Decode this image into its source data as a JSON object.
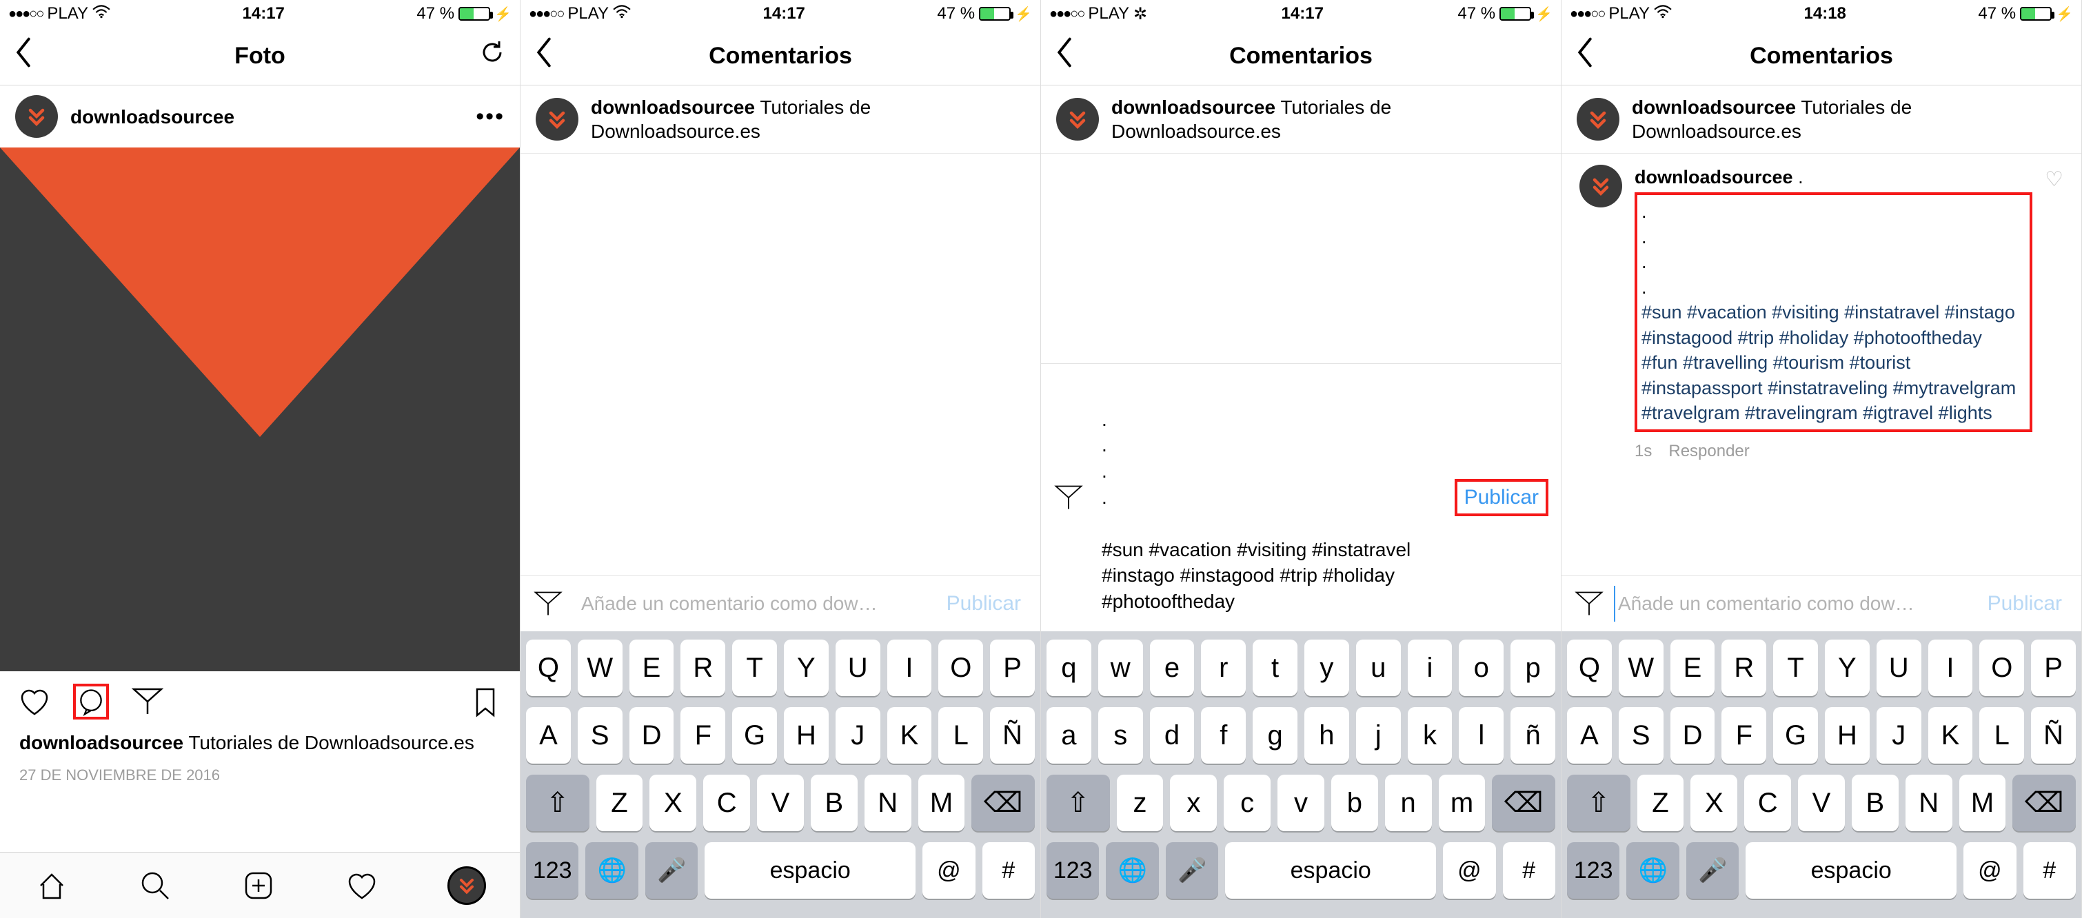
{
  "status": {
    "carrier": "PLAY",
    "dots": "●●●○○",
    "battery_pct": "47 %",
    "battery_fill_pct": 47
  },
  "times": {
    "s1": "14:17",
    "s2": "14:17",
    "s3": "14:17",
    "s4": "14:18"
  },
  "screen1": {
    "nav_title": "Foto",
    "username": "downloadsourcee",
    "caption_user": "downloadsourcee",
    "caption_text": "Tutoriales de Downloadsource.es",
    "date": "27 DE NOVIEMBRE DE 2016"
  },
  "screen2": {
    "nav_title": "Comentarios",
    "username": "downloadsourcee",
    "caption_text": "Tutoriales de Downloadsource.es",
    "placeholder": "Añade un comentario como dow…",
    "publish": "Publicar"
  },
  "screen3": {
    "nav_title": "Comentarios",
    "username": "downloadsourcee",
    "caption_text": "Tutoriales de Downloadsource.es",
    "draft_dots": ".\n.\n.\n.",
    "draft_hashtags": "#sun #vacation #visiting #instatravel #instago #instagood #trip #holiday #photooftheday",
    "publish": "Publicar"
  },
  "screen4": {
    "nav_title": "Comentarios",
    "username": "downloadsourcee",
    "caption_text": "Tutoriales de Downloadsource.es",
    "comment_user": "downloadsourcee",
    "comment_lead": ".",
    "comment_dots": ".\n.\n.\n.",
    "comment_hashtags": "#sun #vacation #visiting #instatravel #instago #instagood #trip #holiday #photooftheday #fun #travelling #tourism #tourist #instapassport #instatraveling #mytravelgram #travelgram #travelingram #igtravel #lights",
    "timestamp": "1s",
    "reply": "Responder",
    "placeholder": "Añade un comentario como dow…",
    "publish": "Publicar"
  },
  "keyboard": {
    "row1_upper": [
      "Q",
      "W",
      "E",
      "R",
      "T",
      "Y",
      "U",
      "I",
      "O",
      "P"
    ],
    "row2_upper": [
      "A",
      "S",
      "D",
      "F",
      "G",
      "H",
      "J",
      "K",
      "L",
      "Ñ"
    ],
    "row3_upper": [
      "Z",
      "X",
      "C",
      "V",
      "B",
      "N",
      "M"
    ],
    "row1_lower": [
      "q",
      "w",
      "e",
      "r",
      "t",
      "y",
      "u",
      "i",
      "o",
      "p"
    ],
    "row2_lower": [
      "a",
      "s",
      "d",
      "f",
      "g",
      "h",
      "j",
      "k",
      "l",
      "ñ"
    ],
    "row3_lower": [
      "z",
      "x",
      "c",
      "v",
      "b",
      "n",
      "m"
    ],
    "space": "espacio",
    "num": "123",
    "at": "@",
    "hash": "#"
  }
}
